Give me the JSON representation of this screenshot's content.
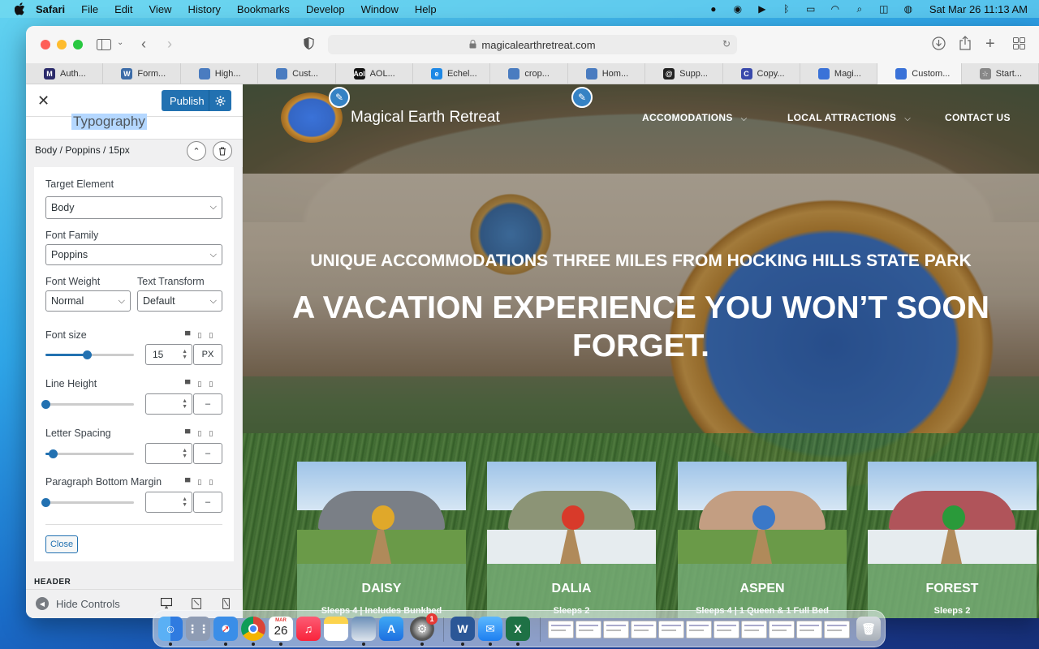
{
  "menubar": {
    "app": "Safari",
    "items": [
      "File",
      "Edit",
      "View",
      "History",
      "Bookmarks",
      "Develop",
      "Window",
      "Help"
    ],
    "clock": "Sat Mar 26  11:13 AM"
  },
  "browser": {
    "url": "magicalearthretreat.com",
    "tabs": [
      {
        "label": "Auth...",
        "fav_color": "#2b2b6b",
        "fav_text": "M"
      },
      {
        "label": "Form...",
        "fav_color": "#3c6ca8",
        "fav_text": "W"
      },
      {
        "label": "High...",
        "fav_color": "#4a7cc0",
        "fav_text": ""
      },
      {
        "label": "Cust...",
        "fav_color": "#4a7cc0",
        "fav_text": ""
      },
      {
        "label": "AOL...",
        "fav_color": "#111111",
        "fav_text": "Aol"
      },
      {
        "label": "Echel...",
        "fav_color": "#1e88e5",
        "fav_text": "e"
      },
      {
        "label": "crop...",
        "fav_color": "#4a7cc0",
        "fav_text": ""
      },
      {
        "label": "Hom...",
        "fav_color": "#4a7cc0",
        "fav_text": ""
      },
      {
        "label": "Supp...",
        "fav_color": "#222222",
        "fav_text": "@"
      },
      {
        "label": "Copy...",
        "fav_color": "#3949ab",
        "fav_text": "C"
      },
      {
        "label": "Magi...",
        "fav_color": "#3a72d8",
        "fav_text": ""
      },
      {
        "label": "Custom...",
        "fav_color": "#3a72d8",
        "fav_text": ""
      },
      {
        "label": "Start...",
        "fav_color": "#888888",
        "fav_text": "☆"
      }
    ]
  },
  "customizer": {
    "publish_label": "Publish",
    "section_title": "Typography",
    "typo_item": "Body / Poppins / 15px",
    "target_element": {
      "label": "Target Element",
      "value": "Body"
    },
    "font_family": {
      "label": "Font Family",
      "value": "Poppins"
    },
    "font_weight": {
      "label": "Font Weight",
      "value": "Normal"
    },
    "text_transform": {
      "label": "Text Transform",
      "value": "Default"
    },
    "font_size": {
      "label": "Font size",
      "value": "15",
      "unit": "PX",
      "slider_fraction": 0.47
    },
    "line_height": {
      "label": "Line Height",
      "value": "",
      "unit": "–",
      "slider_fraction": 0.0
    },
    "letter_spacing": {
      "label": "Letter Spacing",
      "value": "",
      "unit": "–",
      "slider_fraction": 0.08
    },
    "paragraph_margin": {
      "label": "Paragraph Bottom Margin",
      "value": "",
      "unit": "–",
      "slider_fraction": 0.0
    },
    "close_label": "Close",
    "header_section": "HEADER",
    "hide_controls": "Hide Controls",
    "accent_color": "#2271b1"
  },
  "site": {
    "title": "Magical Earth Retreat",
    "nav": [
      {
        "label": "ACCOMODATIONS",
        "has_dropdown": true
      },
      {
        "label": "LOCAL ATTRACTIONS",
        "has_dropdown": true
      },
      {
        "label": "CONTACT US",
        "has_dropdown": false
      }
    ],
    "tagline": "UNIQUE ACCOMMODATIONS THREE MILES FROM HOCKING HILLS STATE PARK",
    "headline": "A VACATION EXPERIENCE YOU WON’T SOON FORGET.",
    "cards": [
      {
        "name": "DAISY",
        "sub": "Sleeps 4 | Includes Bunkbed",
        "door_color": "#e0a82a",
        "house_color": "#7a7f86",
        "ground": "#6a9a48"
      },
      {
        "name": "DALIA",
        "sub": "Sleeps 2",
        "door_color": "#d83a2a",
        "house_color": "#8c9476",
        "ground": "#e6ecef"
      },
      {
        "name": "ASPEN",
        "sub": "Sleeps 4 | 1 Queen & 1 Full Bed",
        "door_color": "#3a78c8",
        "house_color": "#c39e82",
        "ground": "#6a9a48"
      },
      {
        "name": "FOREST",
        "sub": "Sleeps 2",
        "door_color": "#2a9a3a",
        "house_color": "#b0545a",
        "ground": "#e6ecef"
      }
    ]
  },
  "dock": {
    "calendar_month": "MAR",
    "calendar_day": "26",
    "settings_badge": "1"
  }
}
